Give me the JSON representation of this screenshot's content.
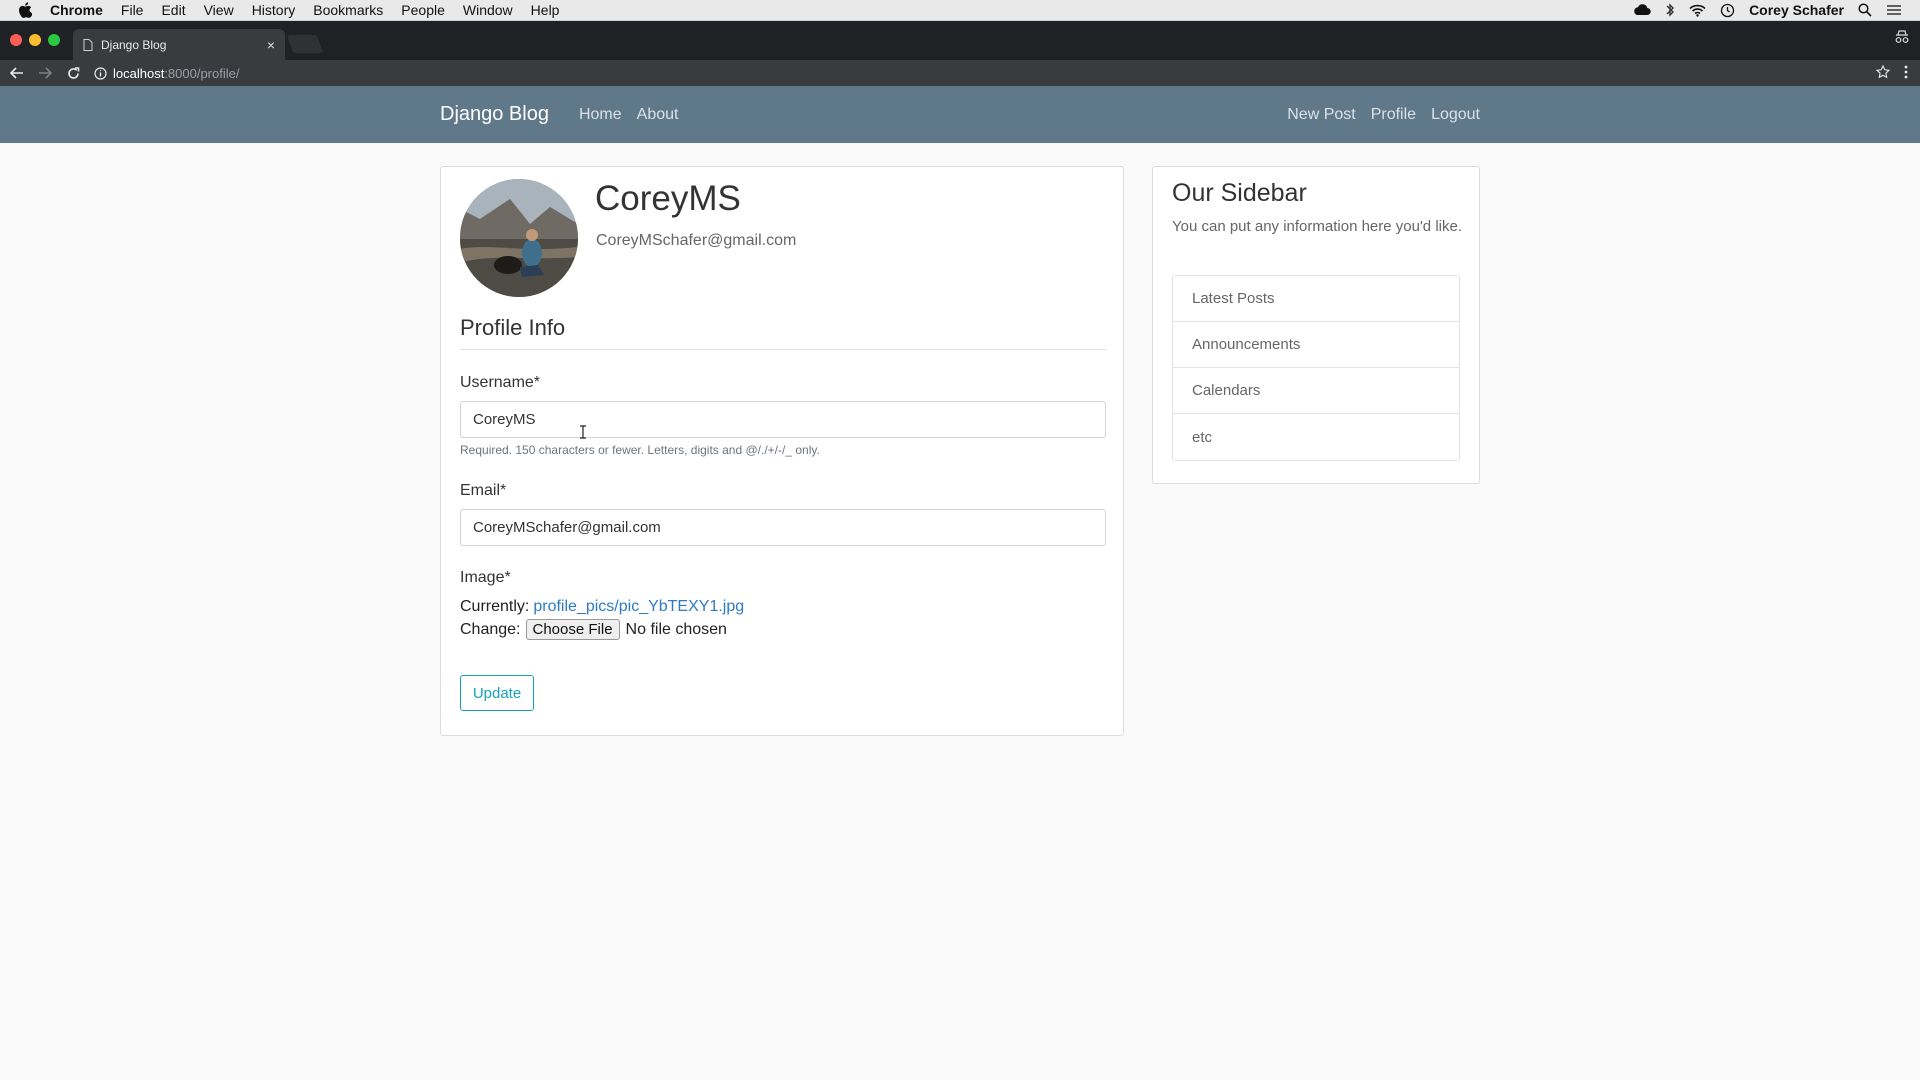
{
  "os_menubar": {
    "app_name": "Chrome",
    "menus": [
      "File",
      "Edit",
      "View",
      "History",
      "Bookmarks",
      "People",
      "Window",
      "Help"
    ],
    "user": "Corey Schafer"
  },
  "browser": {
    "tab_title": "Django Blog",
    "url_host": "localhost",
    "url_path": ":8000/profile/"
  },
  "navbar": {
    "brand": "Django Blog",
    "left_links": [
      "Home",
      "About"
    ],
    "right_links": [
      "New Post",
      "Profile",
      "Logout"
    ]
  },
  "profile": {
    "username": "CoreyMS",
    "email": "CoreyMSchafer@gmail.com",
    "section_title": "Profile Info"
  },
  "form": {
    "username_label": "Username*",
    "username_value": "CoreyMS",
    "username_help": "Required. 150 characters or fewer. Letters, digits and @/./+/-/_ only.",
    "email_label": "Email*",
    "email_value": "CoreyMSchafer@gmail.com",
    "image_label": "Image*",
    "currently_label": "Currently:",
    "current_file": "profile_pics/pic_YbTEXY1.jpg",
    "change_label": "Change:",
    "choose_file": "Choose File",
    "no_file": "No file chosen",
    "submit": "Update"
  },
  "sidebar": {
    "title": "Our Sidebar",
    "text": "You can put any information here you'd like.",
    "items": [
      "Latest Posts",
      "Announcements",
      "Calendars",
      "etc"
    ]
  },
  "colors": {
    "navbar_bg": "#5f788a",
    "link": "#2e7bc4",
    "button_outline": "#17a2b8"
  }
}
